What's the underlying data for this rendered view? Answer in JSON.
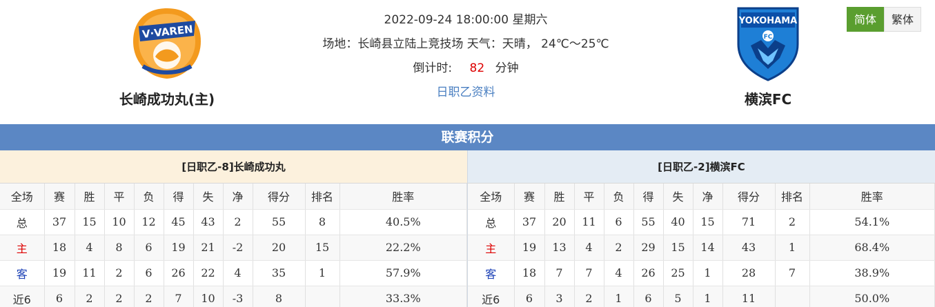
{
  "match": {
    "datetime": "2022-09-24 18:00:00 星期六",
    "venue_line": "场地：长崎县立陆上竞技场 天气：天晴， 24℃～25℃",
    "countdown_label": "倒计时:",
    "countdown_value": "82",
    "countdown_unit": "分钟",
    "league_link": "日职乙资料"
  },
  "home_team": {
    "name": "长崎成功丸(主)",
    "logo_icon": "v-varen-nagasaki-crest-icon"
  },
  "away_team": {
    "name": "横滨FC",
    "logo_icon": "yokohama-fc-crest-icon"
  },
  "lang": {
    "simplified": "简体",
    "traditional": "繁体",
    "active": "simplified"
  },
  "section_title": "联赛积分",
  "columns": [
    "全场",
    "赛",
    "胜",
    "平",
    "负",
    "得",
    "失",
    "净",
    "得分",
    "排名",
    "胜率"
  ],
  "home_standings": {
    "title": "[日职乙-8]长崎成功丸",
    "rows": [
      [
        "总",
        "37",
        "15",
        "10",
        "12",
        "45",
        "43",
        "2",
        "55",
        "8",
        "40.5%"
      ],
      [
        "主",
        "18",
        "4",
        "8",
        "6",
        "19",
        "21",
        "-2",
        "20",
        "15",
        "22.2%"
      ],
      [
        "客",
        "19",
        "11",
        "2",
        "6",
        "26",
        "22",
        "4",
        "35",
        "1",
        "57.9%"
      ],
      [
        "近6",
        "6",
        "2",
        "2",
        "2",
        "7",
        "10",
        "-3",
        "8",
        "",
        "33.3%"
      ]
    ]
  },
  "away_standings": {
    "title": "[日职乙-2]横滨FC",
    "rows": [
      [
        "总",
        "37",
        "20",
        "11",
        "6",
        "55",
        "40",
        "15",
        "71",
        "2",
        "54.1%"
      ],
      [
        "主",
        "19",
        "13",
        "4",
        "2",
        "29",
        "15",
        "14",
        "43",
        "1",
        "68.4%"
      ],
      [
        "客",
        "18",
        "7",
        "7",
        "4",
        "26",
        "25",
        "1",
        "28",
        "7",
        "38.9%"
      ],
      [
        "近6",
        "6",
        "3",
        "2",
        "1",
        "6",
        "5",
        "1",
        "11",
        "",
        "50.0%"
      ]
    ]
  },
  "colors": {
    "accent_blue": "#5b87c4",
    "home_label": "#dd0000",
    "away_label": "#1a3fb5",
    "lang_active": "#5a9e2f"
  }
}
